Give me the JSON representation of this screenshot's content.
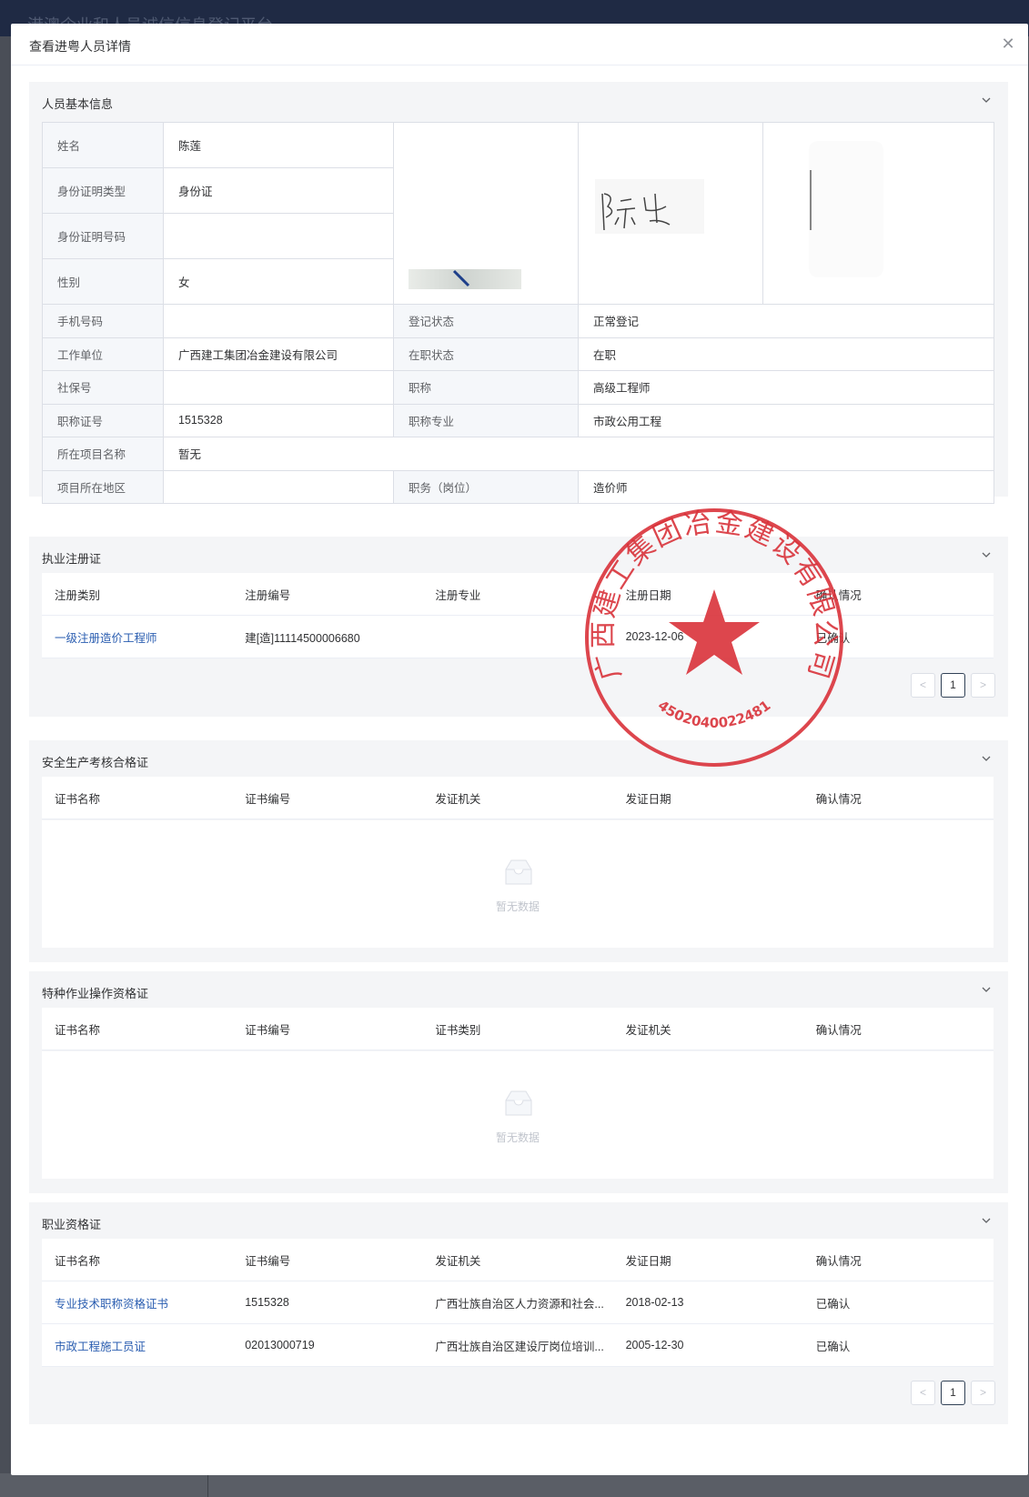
{
  "background": {
    "title": "港澳企业和人员诚信信息登记平台"
  },
  "dialog": {
    "title": "查看进粤人员详情",
    "close_icon": "close-icon"
  },
  "basic": {
    "title": "人员基本信息",
    "name_label": "姓名",
    "name": "陈莲",
    "id_type_label": "身份证明类型",
    "id_type": "身份证",
    "id_no_label": "身份证明号码",
    "id_no": "",
    "gender_label": "性别",
    "gender": "女",
    "phone_label": "手机号码",
    "phone": "",
    "reg_status_label": "登记状态",
    "reg_status": "正常登记",
    "work_unit_label": "工作单位",
    "work_unit": "广西建工集团冶金建设有限公司",
    "job_status_label": "在职状态",
    "job_status": "在职",
    "social_label": "社保号",
    "social": "",
    "title_label": "职称",
    "title_val": "高级工程师",
    "title_no_label": "职称证号",
    "title_no": "1515328",
    "title_major_label": "职称专业",
    "title_major": "市政公用工程",
    "project_label": "所在项目名称",
    "project": "暂无",
    "region_label": "项目所在地区",
    "region": "",
    "post_label": "职务（岗位）",
    "post": "造价师"
  },
  "stamp": {
    "text": "广西建工集团冶金建设有限公司",
    "number": "4502040022481",
    "color": "#d9323a"
  },
  "reg_cert": {
    "title": "执业注册证",
    "columns": [
      "注册类别",
      "注册编号",
      "注册专业",
      "注册日期",
      "确认情况"
    ],
    "rows": [
      [
        "一级注册造价工程师",
        "建[造]11114500006680",
        "",
        "2023-12-06",
        "已确认"
      ]
    ],
    "pager": {
      "page": "1",
      "prev": "<",
      "next": ">"
    }
  },
  "safety": {
    "title": "安全生产考核合格证",
    "columns": [
      "证书名称",
      "证书编号",
      "发证机关",
      "发证日期",
      "确认情况"
    ],
    "empty": "暂无数据"
  },
  "special": {
    "title": "特种作业操作资格证",
    "columns": [
      "证书名称",
      "证书编号",
      "证书类别",
      "发证机关",
      "确认情况"
    ],
    "empty": "暂无数据"
  },
  "prof": {
    "title": "职业资格证",
    "columns": [
      "证书名称",
      "证书编号",
      "发证机关",
      "发证日期",
      "确认情况"
    ],
    "rows": [
      [
        "专业技术职称资格证书",
        "1515328",
        "广西壮族自治区人力资源和社会...",
        "2018-02-13",
        "已确认"
      ],
      [
        "市政工程施工员证",
        "02013000719",
        "广西壮族自治区建设厅岗位培训...",
        "2005-12-30",
        "已确认"
      ]
    ],
    "pager": {
      "page": "1",
      "prev": "<",
      "next": ">"
    }
  }
}
